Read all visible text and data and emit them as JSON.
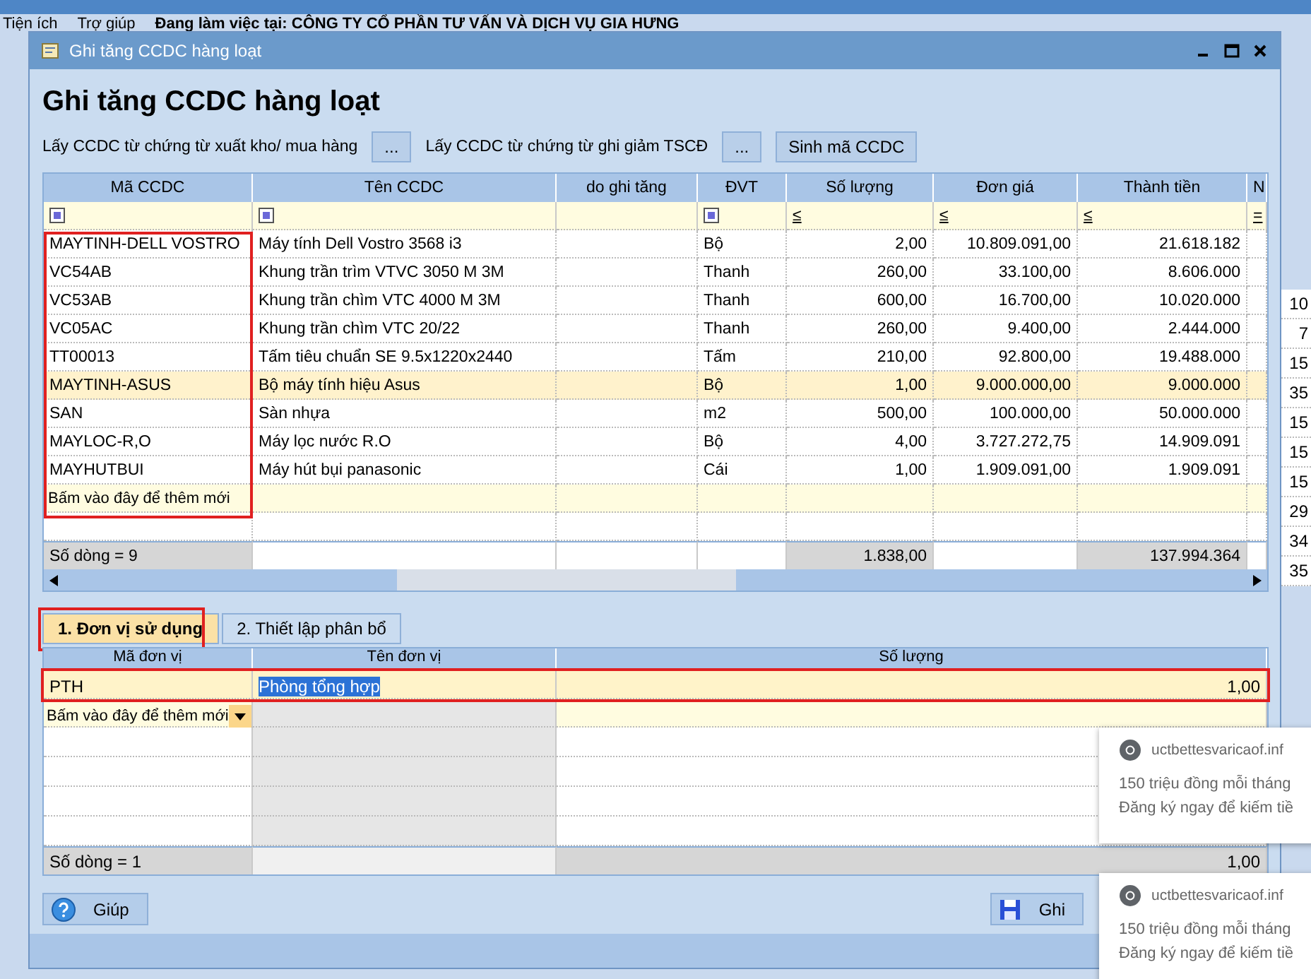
{
  "background": {
    "menu": [
      "Tiện ích",
      "Trợ giúp",
      "Đang làm việc tại: CÔNG TY CỔ PHẦN TƯ VẤN VÀ DỊCH VỤ GIA HƯNG"
    ],
    "side_values": [
      "10",
      "7",
      "15",
      "35",
      "15",
      "15",
      "15",
      "29",
      "34",
      "35"
    ]
  },
  "window": {
    "title": "Ghi tăng CCDC hàng loạt"
  },
  "heading": "Ghi tăng CCDC hàng loạt",
  "toolbar": [
    {
      "kind": "label",
      "text": "Lấy CCDC từ chứng từ xuất kho/ mua hàng"
    },
    {
      "kind": "button",
      "text": "..."
    },
    {
      "kind": "label",
      "text": "Lấy CCDC từ chứng từ ghi giảm TSCĐ"
    },
    {
      "kind": "button",
      "text": "..."
    },
    {
      "kind": "button",
      "text": "Sinh mã CCDC"
    }
  ],
  "grid": {
    "columns": [
      {
        "label": "Mã CCDC",
        "numeric": false
      },
      {
        "label": "Tên CCDC",
        "numeric": false
      },
      {
        "label": "do ghi tăng"
      },
      {
        "label": "ĐVT",
        "numeric": false
      },
      {
        "label": "Số lượng",
        "numeric": true
      },
      {
        "label": "Đơn giá",
        "numeric": true
      },
      {
        "label": "Thành tiền",
        "numeric": true
      },
      {
        "label": "N"
      }
    ],
    "filters": [
      {
        "kind": "checkbox",
        "checked": true
      },
      {
        "kind": "checkbox",
        "checked": true
      },
      {
        "kind": "blank"
      },
      {
        "kind": "checkbox",
        "checked": true
      },
      {
        "kind": "operator",
        "text": "≤"
      },
      {
        "kind": "operator",
        "text": "≤"
      },
      {
        "kind": "operator",
        "text": "≤"
      },
      {
        "kind": "operator",
        "text": "="
      }
    ],
    "rows": [
      {
        "selected": false,
        "cells": [
          "MAYTINH-DELL VOSTRO",
          "Máy tính Dell Vostro 3568 i3",
          null,
          "Bộ",
          "2,00",
          "10.809.091,00",
          "21.618.182",
          null
        ]
      },
      {
        "selected": false,
        "cells": [
          "VC54AB",
          "Khung trần trìm VTVC 3050 M 3M",
          null,
          "Thanh",
          "260,00",
          "33.100,00",
          "8.606.000",
          null
        ]
      },
      {
        "selected": false,
        "cells": [
          "VC53AB",
          "Khung trần chìm VTC 4000 M 3M",
          null,
          "Thanh",
          "600,00",
          "16.700,00",
          "10.020.000",
          null
        ]
      },
      {
        "selected": false,
        "cells": [
          "VC05AC",
          "Khung trần chìm VTC 20/22",
          null,
          "Thanh",
          "260,00",
          "9.400,00",
          "2.444.000",
          null
        ]
      },
      {
        "selected": false,
        "cells": [
          "TT00013",
          "Tấm tiêu chuẩn SE 9.5x1220x2440",
          null,
          "Tấm",
          "210,00",
          "92.800,00",
          "19.488.000",
          null
        ]
      },
      {
        "selected": true,
        "cells": [
          "MAYTINH-ASUS",
          "Bộ máy tính hiệu Asus",
          null,
          "Bộ",
          "1,00",
          "9.000.000,00",
          "9.000.000",
          null
        ]
      },
      {
        "selected": false,
        "cells": [
          "SAN",
          "Sàn nhựa",
          null,
          "m2",
          "500,00",
          "100.000,00",
          "50.000.000",
          null
        ]
      },
      {
        "selected": false,
        "cells": [
          "MAYLOC-R,O",
          "Máy lọc nước R.O",
          null,
          "Bộ",
          "4,00",
          "3.727.272,75",
          "14.909.091",
          null
        ]
      },
      {
        "selected": false,
        "cells": [
          "MAYHUTBUI",
          "Máy hút bụi panasonic",
          null,
          "Cái",
          "1,00",
          "1.909.091,00",
          "1.909.091",
          null
        ]
      }
    ],
    "add_row": "Bấm vào đây để thêm mới",
    "footer": [
      {
        "kind": "count",
        "text": "Số dòng = 9"
      },
      {
        "kind": "blank"
      },
      {
        "kind": "blank"
      },
      {
        "kind": "blank"
      },
      {
        "kind": "sum",
        "text": "1.838,00"
      },
      {
        "kind": "blank"
      },
      {
        "kind": "sum",
        "text": "137.994.364"
      },
      {
        "kind": "blank"
      }
    ]
  },
  "tabs": [
    {
      "label": "1. Đơn vị sử dụng",
      "selected": true
    },
    {
      "label": "2. Thiết lập phân bổ",
      "selected": false
    }
  ],
  "unit_grid": {
    "columns": [
      {
        "label": "Mã đơn vị",
        "numeric": false
      },
      {
        "label": "Tên đơn vị",
        "numeric": false
      },
      {
        "label": "Số lượng",
        "numeric": true
      }
    ],
    "rows": [
      {
        "selected": true,
        "cells": [
          "PTH",
          "Phòng tổng hợp",
          "1,00"
        ]
      }
    ],
    "add_row": "Bấm vào đây để thêm mới",
    "footer": [
      {
        "kind": "count",
        "text": "Số dòng = 1"
      },
      {
        "kind": "blank"
      },
      {
        "kind": "sum",
        "text": "1,00"
      }
    ]
  },
  "buttons": [
    {
      "kind": "help",
      "label": "Giúp"
    },
    {
      "kind": "save",
      "label": "Ghi"
    }
  ],
  "notifications": [
    {
      "site": "uctbettesvaricaof.inf",
      "line_1": "150 triệu đồng mỗi tháng",
      "line_2": "Đăng ký ngay để kiếm tiề"
    },
    {
      "site": "uctbettesvaricaof.inf",
      "line_1": "150 triệu đồng mỗi tháng",
      "line_2": "Đăng ký ngay để kiếm tiề"
    }
  ]
}
